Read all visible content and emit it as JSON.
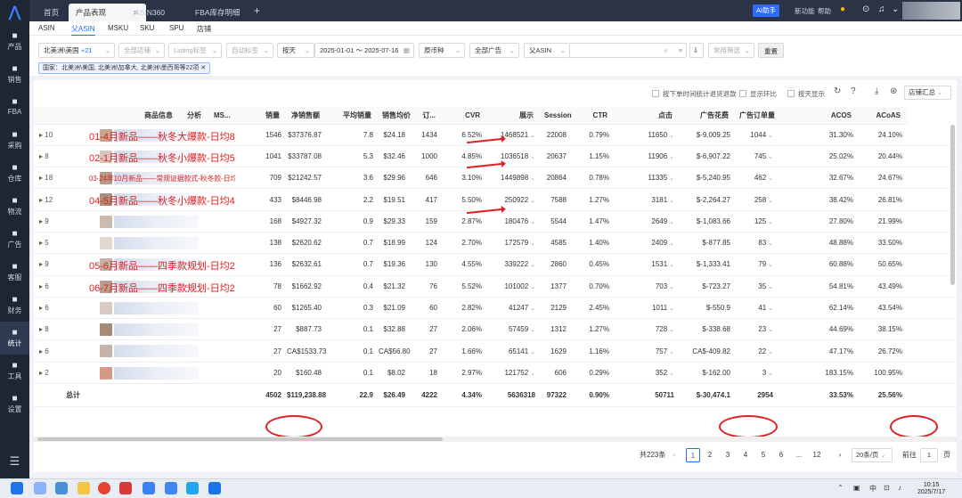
{
  "sidebar": {
    "items": [
      {
        "icon": "box-icon",
        "label": "产品"
      },
      {
        "icon": "store-icon",
        "label": "销售"
      },
      {
        "icon": "fba-icon",
        "label": "FBA"
      },
      {
        "icon": "cart-icon",
        "label": "采购"
      },
      {
        "icon": "warehouse-icon",
        "label": "仓库"
      },
      {
        "icon": "truck-icon",
        "label": "物流"
      },
      {
        "icon": "megaphone-icon",
        "label": "广告"
      },
      {
        "icon": "mail-icon",
        "label": "客服"
      },
      {
        "icon": "coin-icon",
        "label": "财务"
      },
      {
        "icon": "pie-chart-icon",
        "label": "统计"
      },
      {
        "icon": "wrench-icon",
        "label": "工具"
      },
      {
        "icon": "gear-icon",
        "label": "设置"
      }
    ]
  },
  "topbar": {
    "tabs": [
      "首页",
      "产品表现",
      "ASIN360",
      "FBA库存明细"
    ],
    "ai_button": "AI助手",
    "links": [
      "新功能",
      "帮助"
    ]
  },
  "subtabs": [
    "ASIN",
    "父ASIN",
    "MSKU",
    "SKU",
    "SPU",
    "店铺"
  ],
  "filters": {
    "region": "北美洲\\美国",
    "region_more": "+21",
    "shop": "全部店铺",
    "listing": "Listing标签",
    "auto": "自动标签",
    "period": "按天",
    "date_range": "2025-01-01 ～ 2025-07-16",
    "currency": "原币种",
    "ads": "全部广告",
    "search_type": "父ASIN",
    "common": "常用筛选",
    "reset": "重置",
    "country_tag": "国家：北美洲\\美国, 北美洲\\加拿大, 北美洲\\墨西哥等22项"
  },
  "toolbar": {
    "opt1": "按下单时间统计退货退款",
    "opt2": "显示环比",
    "opt3": "按天显示",
    "shop_summary": "店铺汇总"
  },
  "columns": [
    "商品信息",
    "分析",
    "MS...",
    "销量",
    "净销售额",
    "平均销量",
    "销售均价",
    "订...",
    "CVR",
    "展示",
    "Session...",
    "CTR",
    "点击",
    "广告花费",
    "广告订单量",
    "ACOS",
    "ACoAS"
  ],
  "rows": [
    {
      "n": "10",
      "ann": "01-4月新品——秋冬大爆款-日均80单",
      "sales": "1546",
      "net": "$37376.87",
      "avg": "7.8",
      "price": "$24.18",
      "orders": "1434",
      "cvr": "6.52%",
      "imp": "1468521",
      "sess": "22008",
      "ctr": "0.79%",
      "clicks": "11650",
      "spend": "$-9,009.25",
      "adorders": "1044",
      "acos": "31.30%",
      "acoas": "24.10%"
    },
    {
      "n": "8",
      "ann": "02-1月新品——秋冬小爆款-日均50单",
      "sales": "1041",
      "net": "$33787.08",
      "avg": "5.3",
      "price": "$32.46",
      "orders": "1000",
      "cvr": "4.85%",
      "imp": "1036518",
      "sess": "20637",
      "ctr": "1.15%",
      "clicks": "11906",
      "spend": "$-6,907.22",
      "adorders": "745",
      "acos": "25.02%",
      "acoas": "20.44%"
    },
    {
      "n": "18",
      "ann": "03-24年10月新品——常规证据款式-秋冬款-日均10单",
      "sales": "709",
      "net": "$21242.57",
      "avg": "3.6",
      "price": "$29.96",
      "orders": "646",
      "cvr": "3.10%",
      "imp": "1449898",
      "sess": "20864",
      "ctr": "0.78%",
      "clicks": "11335",
      "spend": "$-5,240.95",
      "adorders": "462",
      "acos": "32.67%",
      "acoas": "24.67%"
    },
    {
      "n": "12",
      "ann": "04-5月新品——秋冬小爆款-日均40单",
      "sales": "433",
      "net": "$8446.98",
      "avg": "2.2",
      "price": "$19.51",
      "orders": "417",
      "cvr": "5.50%",
      "imp": "250922",
      "sess": "7588",
      "ctr": "1.27%",
      "clicks": "3181",
      "spend": "$-2,264.27",
      "adorders": "258",
      "acos": "38.42%",
      "acoas": "26.81%"
    },
    {
      "n": "9",
      "ann": "",
      "sales": "168",
      "net": "$4927.32",
      "avg": "0.9",
      "price": "$29.33",
      "orders": "159",
      "cvr": "2.87%",
      "imp": "180476",
      "sess": "5544",
      "ctr": "1.47%",
      "clicks": "2649",
      "spend": "$-1,083.66",
      "adorders": "125",
      "acos": "27.80%",
      "acoas": "21.99%"
    },
    {
      "n": "5",
      "ann": "",
      "sales": "138",
      "net": "$2620.62",
      "avg": "0.7",
      "price": "$18.99",
      "orders": "124",
      "cvr": "2.70%",
      "imp": "172579",
      "sess": "4585",
      "ctr": "1.40%",
      "clicks": "2409",
      "spend": "$-877.85",
      "adorders": "83",
      "acos": "48.88%",
      "acoas": "33.50%"
    },
    {
      "n": "9",
      "ann": "05-6月新品——四季款规划-日均20单",
      "sales": "136",
      "net": "$2632.61",
      "avg": "0.7",
      "price": "$19.36",
      "orders": "130",
      "cvr": "4.55%",
      "imp": "339222",
      "sess": "2860",
      "ctr": "0.45%",
      "clicks": "1531",
      "spend": "$-1,333.41",
      "adorders": "79",
      "acos": "60.88%",
      "acoas": "50.65%"
    },
    {
      "n": "6",
      "ann": "06-7月新品——四季款规划-日均20单",
      "sales": "78",
      "net": "$1662.92",
      "avg": "0.4",
      "price": "$21.32",
      "orders": "76",
      "cvr": "5.52%",
      "imp": "101002",
      "sess": "1377",
      "ctr": "0.70%",
      "clicks": "703",
      "spend": "$-723.27",
      "adorders": "35",
      "acos": "54.81%",
      "acoas": "43.49%"
    },
    {
      "n": "6",
      "ann": "",
      "sales": "60",
      "net": "$1265.40",
      "avg": "0.3",
      "price": "$21.09",
      "orders": "60",
      "cvr": "2.82%",
      "imp": "41247",
      "sess": "2129",
      "ctr": "2.45%",
      "clicks": "1011",
      "spend": "$-550.9",
      "adorders": "41",
      "acos": "62.14%",
      "acoas": "43.54%"
    },
    {
      "n": "8",
      "ann": "",
      "sales": "27",
      "net": "$887.73",
      "avg": "0.1",
      "price": "$32.88",
      "orders": "27",
      "cvr": "2.06%",
      "imp": "57459",
      "sess": "1312",
      "ctr": "1.27%",
      "clicks": "728",
      "spend": "$-338.68",
      "adorders": "23",
      "acos": "44.69%",
      "acoas": "38.15%"
    },
    {
      "n": "6",
      "ann": "",
      "sales": "27",
      "net": "CA$1533.73",
      "avg": "0.1",
      "price": "CA$56.80",
      "orders": "27",
      "cvr": "1.66%",
      "imp": "65141",
      "sess": "1629",
      "ctr": "1.16%",
      "clicks": "757",
      "spend": "CA$-409.82",
      "adorders": "22",
      "acos": "47.17%",
      "acoas": "26.72%"
    },
    {
      "n": "2",
      "ann": "",
      "sales": "20",
      "net": "$160.48",
      "avg": "0.1",
      "price": "$8.02",
      "orders": "18",
      "cvr": "2.97%",
      "imp": "121752",
      "sess": "606",
      "ctr": "0.29%",
      "clicks": "352",
      "spend": "$-162.00",
      "adorders": "3",
      "acos": "183.15%",
      "acoas": "100.95%"
    }
  ],
  "total": {
    "label": "总计",
    "sales": "4502",
    "net": "$119,238.88",
    "avg": "22.9",
    "price": "$26.49",
    "orders": "4222",
    "cvr": "4.34%",
    "imp": "5636318",
    "sess": "97322",
    "ctr": "0.90%",
    "clicks": "50711",
    "spend": "$-30,474.1",
    "adorders": "2954",
    "acos": "33.53%",
    "acoas": "25.56%"
  },
  "pager": {
    "total": "共223条",
    "pages": [
      "1",
      "2",
      "3",
      "4",
      "5",
      "6",
      "...",
      "12"
    ],
    "size": "20条/页",
    "goto": "前往",
    "page": "1",
    "unit": "页"
  },
  "clock": {
    "time": "10:15",
    "date": "2025/7/17",
    "ime": "中"
  }
}
